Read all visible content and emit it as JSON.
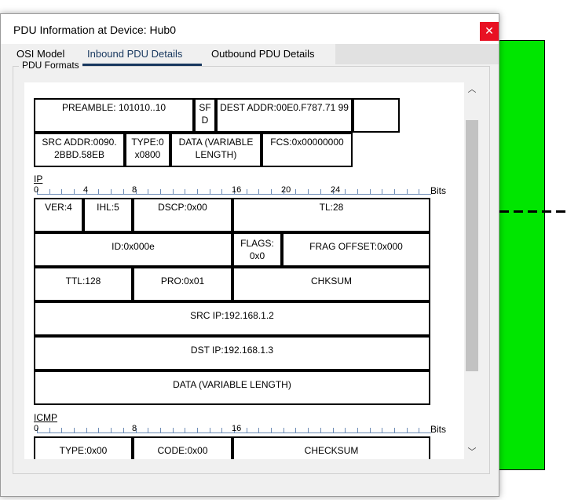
{
  "window": {
    "title": "PDU Information at Device: Hub0",
    "close_glyph": "✕",
    "close_icon": "close-icon"
  },
  "tabs": [
    {
      "label": "OSI Model",
      "active": false
    },
    {
      "label": "Inbound PDU Details",
      "active": true
    },
    {
      "label": "Outbound PDU Details",
      "active": false
    }
  ],
  "group": {
    "legend": "PDU Formats"
  },
  "scroll": {
    "up_glyph": "︿",
    "down_glyph": "﹀",
    "up_icon": "chevron-up-icon",
    "down_icon": "chevron-down-icon"
  },
  "ethernet": {
    "preamble": "PREAMBLE: 101010..10",
    "sfd": "SF D",
    "dest": "DEST ADDR:00E0.F787.71 99",
    "src": "SRC ADDR:0090. 2BBD.58EB",
    "type": "TYPE:0 x0800",
    "data": "DATA (VARIABLE LENGTH)",
    "fcs": "FCS:0x00000000"
  },
  "ip": {
    "label": "IP",
    "ticks": [
      "0",
      "4",
      "8",
      "16",
      "20",
      "24"
    ],
    "bits_label": "Bits",
    "ver": "VER:4",
    "ihl": "IHL:5",
    "dscp": "DSCP:0x00",
    "tl": "TL:28",
    "id": "ID:0x000e",
    "flags": "FLAGS: 0x0",
    "frag": "FRAG OFFSET:0x000",
    "ttl": "TTL:128",
    "pro": "PRO:0x01",
    "chksum": "CHKSUM",
    "src": "SRC IP:192.168.1.2",
    "dst": "DST IP:192.168.1.3",
    "data": "DATA (VARIABLE LENGTH)"
  },
  "icmp": {
    "label": "ICMP",
    "ticks": [
      "0",
      "8",
      "16"
    ],
    "bits_label": "Bits",
    "type": "TYPE:0x00",
    "code": "CODE:0x00",
    "checksum": "CHECKSUM"
  },
  "colors": {
    "background_device": "#00e600",
    "close": "#e81123",
    "active_tab": "#17375e"
  }
}
